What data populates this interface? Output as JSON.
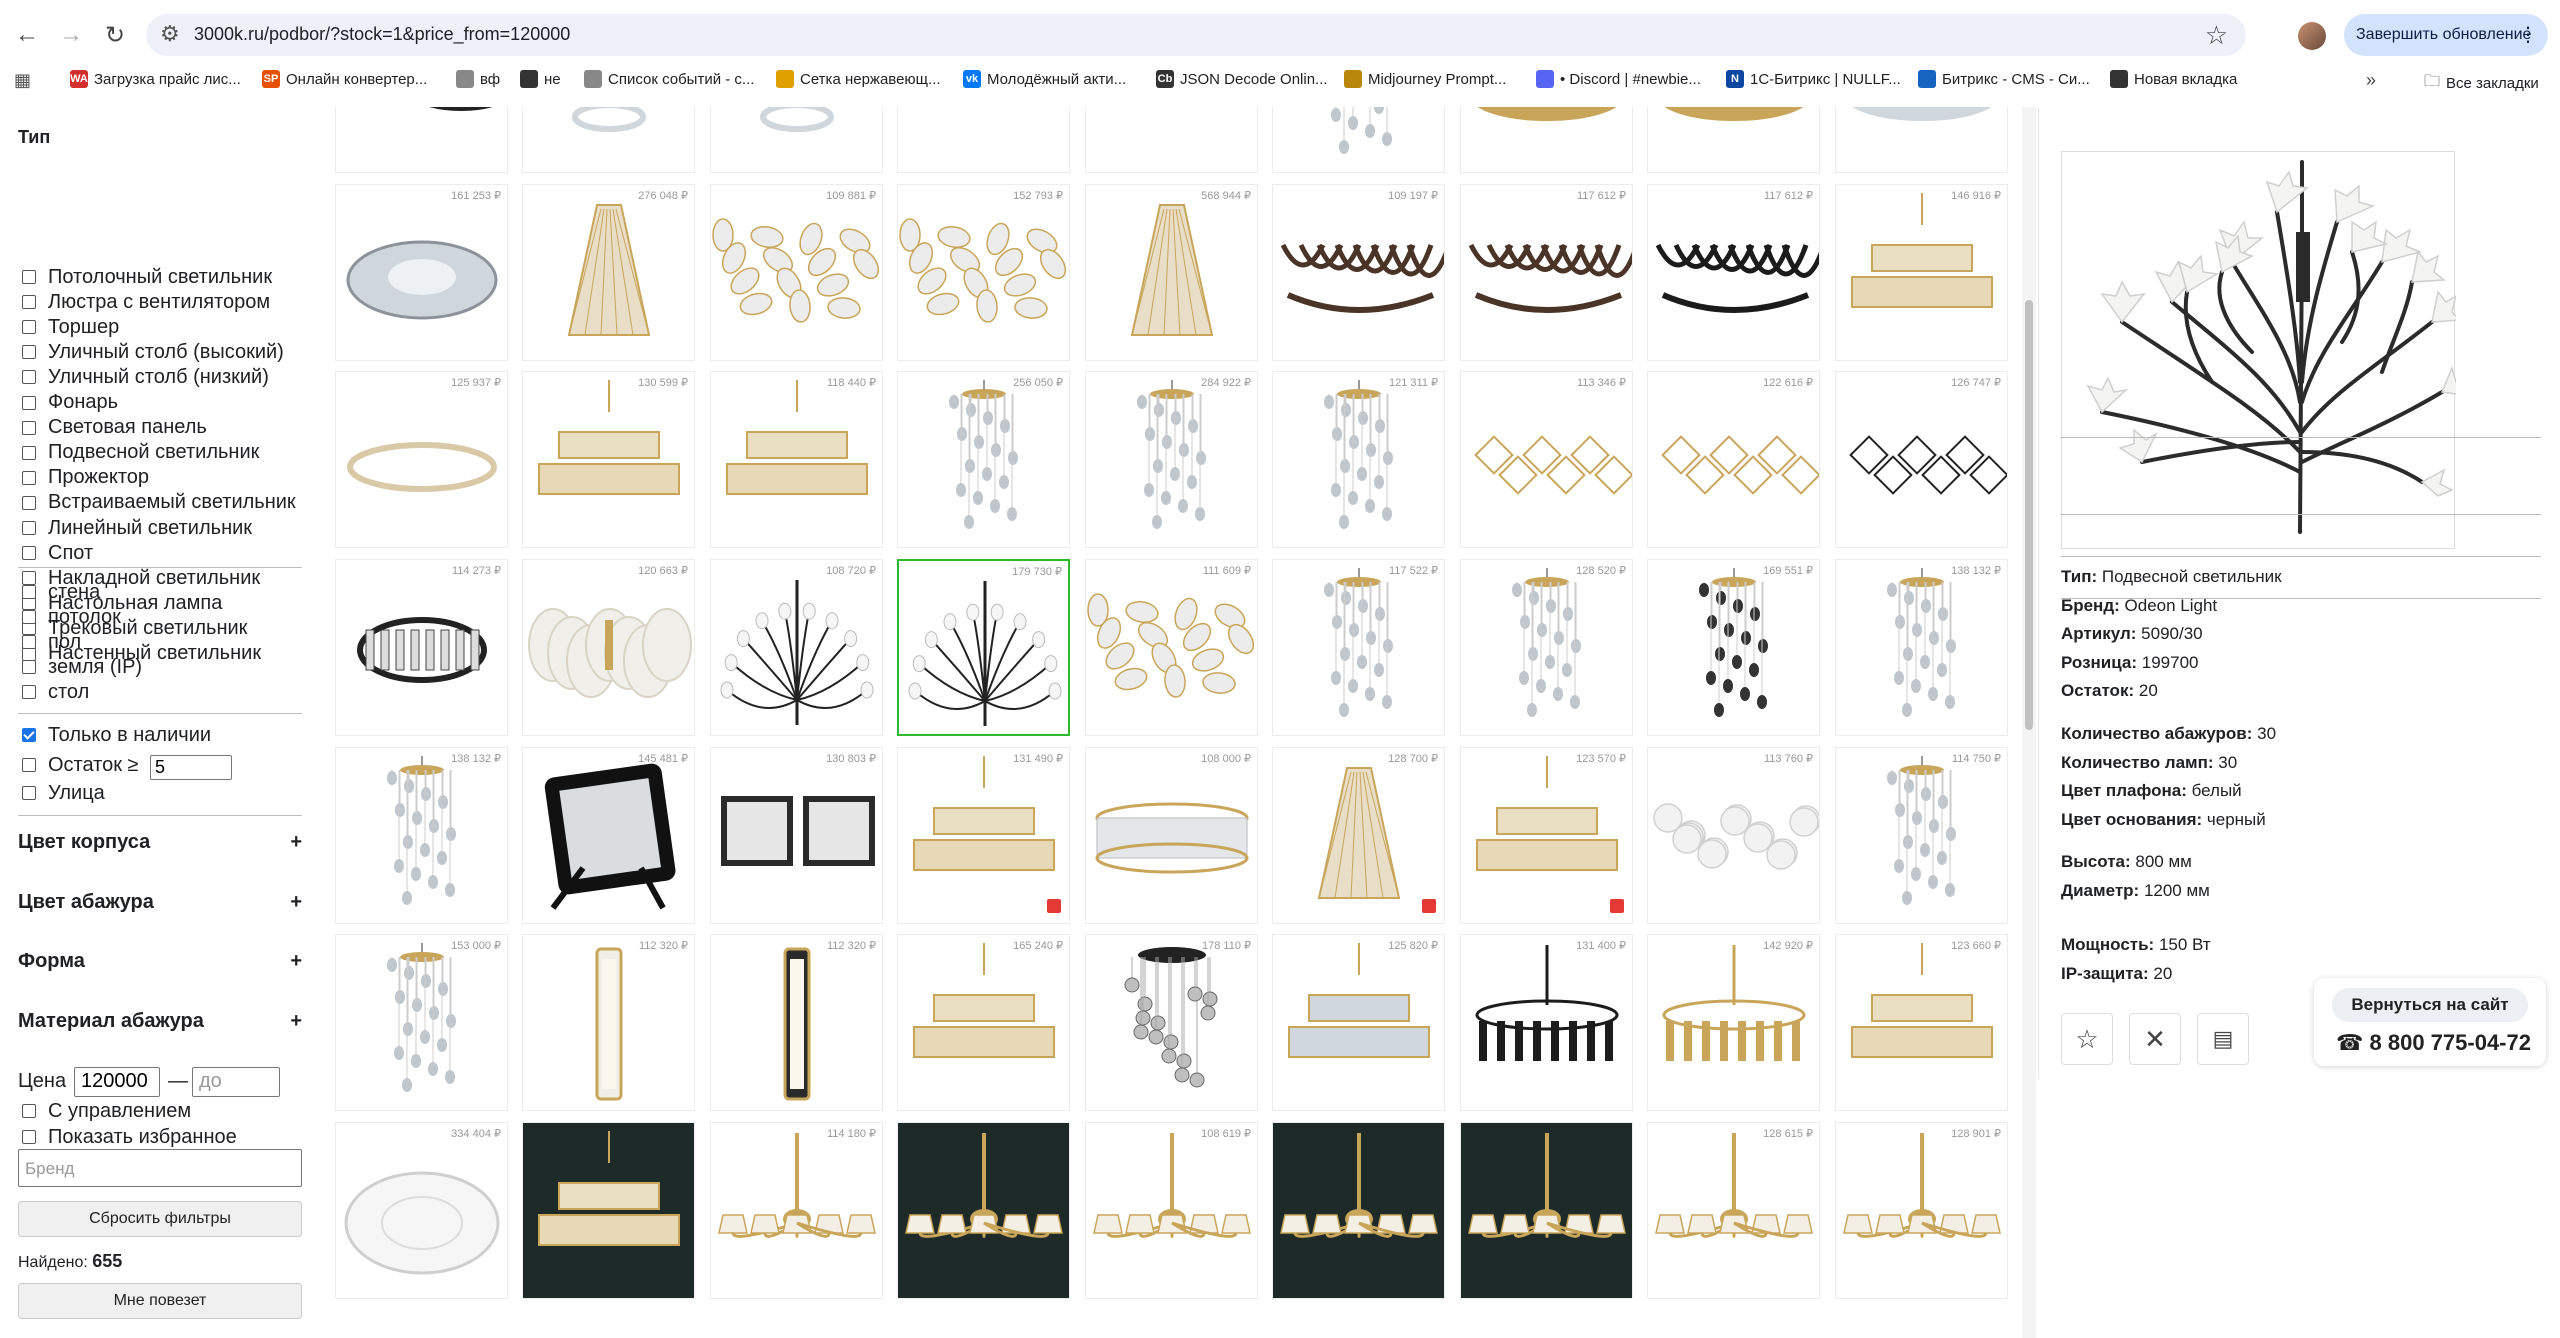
{
  "browser": {
    "url": "3000k.ru/podbor/?stock=1&price_from=120000",
    "update_label": "Завершить обновление",
    "bookmarks": [
      {
        "label": "Загрузка прайс лис...",
        "color": "#d32f2f",
        "glyph": "WA"
      },
      {
        "label": "Онлайн конвертер...",
        "color": "#e65100",
        "glyph": "SP"
      },
      {
        "label": "вф",
        "color": "#888888",
        "glyph": ""
      },
      {
        "label": "не",
        "color": "#333333",
        "glyph": ""
      },
      {
        "label": "Список событий - с...",
        "color": "#888888",
        "glyph": ""
      },
      {
        "label": "Сетка нержавеющ...",
        "color": "#e0a000",
        "glyph": ""
      },
      {
        "label": "Молодёжный акти...",
        "color": "#0077ff",
        "glyph": "vk"
      },
      {
        "label": "JSON Decode Onlin...",
        "color": "#333333",
        "glyph": "Cb"
      },
      {
        "label": "Midjourney Prompt...",
        "color": "#b8860b",
        "glyph": ""
      },
      {
        "label": "• Discord | #newbie...",
        "color": "#5865f2",
        "glyph": ""
      },
      {
        "label": "1С-Битрикс | NULLF...",
        "color": "#0d47a1",
        "glyph": "N"
      },
      {
        "label": "Битрикс - CMS - Си...",
        "color": "#1565c0",
        "glyph": ""
      },
      {
        "label": "Новая вкладка",
        "color": "#333333",
        "glyph": ""
      }
    ],
    "all_bookmarks": "Все закладки"
  },
  "sidebar": {
    "type_title": "Тип",
    "types": [
      {
        "label": "Потолочный светильник",
        "checked": false
      },
      {
        "label": "Люстра с вентилятором",
        "checked": false
      },
      {
        "label": "Торшер",
        "checked": false
      },
      {
        "label": "Уличный столб (высокий)",
        "checked": false
      },
      {
        "label": "Уличный столб (низкий)",
        "checked": false
      },
      {
        "label": "Фонарь",
        "checked": false
      },
      {
        "label": "Световая панель",
        "checked": false
      },
      {
        "label": "Подвесной светильник",
        "checked": false
      },
      {
        "label": "Прожектор",
        "checked": false
      },
      {
        "label": "Встраиваемый светильник",
        "checked": false
      },
      {
        "label": "Линейный светильник",
        "checked": false
      },
      {
        "label": "Спот",
        "checked": false
      },
      {
        "label": "Накладной светильник",
        "checked": false
      },
      {
        "label": "Настольная лампа",
        "checked": false
      },
      {
        "label": "Трековый светильник",
        "checked": false
      },
      {
        "label": "Настенный светильник",
        "checked": false
      }
    ],
    "mounts": [
      {
        "label": "стена",
        "checked": false
      },
      {
        "label": "потолок",
        "checked": false
      },
      {
        "label": "пол",
        "checked": false
      },
      {
        "label": "земля (IP)",
        "checked": false
      },
      {
        "label": "стол",
        "checked": false
      }
    ],
    "in_stock": {
      "label": "Только в наличии",
      "checked": true
    },
    "stock_min": {
      "label": "Остаток ≥",
      "value": "5",
      "checked": false
    },
    "street": {
      "label": "Улица",
      "checked": false
    },
    "accordions": [
      "Цвет корпуса",
      "Цвет абажура",
      "Форма",
      "Материал абажура"
    ],
    "accordion_plus": "+",
    "price_label": "Цена",
    "price_from": "120000",
    "price_dash": "—",
    "price_to_placeholder": "до",
    "with_control": {
      "label": "С управлением",
      "checked": false
    },
    "show_favorites": {
      "label": "Показать избранное",
      "checked": false
    },
    "brand_placeholder": "Бренд",
    "reset_label": "Сбросить фильтры",
    "found_label": "Найдено:",
    "found_count": "655",
    "lucky_label": "Мне повезет"
  },
  "grid": {
    "rows": [
      [
        {
          "price": "",
          "kind": "rings-black"
        },
        {
          "price": "",
          "kind": "spiral"
        },
        {
          "price": "",
          "kind": "spiral"
        },
        {
          "price": "",
          "kind": "stones-pink"
        },
        {
          "price": "",
          "kind": "stones-grey"
        },
        {
          "price": "",
          "kind": "drops"
        },
        {
          "price": "",
          "kind": "ring-gold"
        },
        {
          "price": "",
          "kind": "ring-gold"
        },
        {
          "price": "",
          "kind": "ring-crystal"
        }
      ],
      [
        {
          "price": "161 253 ₽",
          "kind": "flower-crystal"
        },
        {
          "price": "276 048 ₽",
          "kind": "cone-gold"
        },
        {
          "price": "109 881 ₽",
          "kind": "leaves-white"
        },
        {
          "price": "152 793 ₽",
          "kind": "leaves-white"
        },
        {
          "price": "568 944 ₽",
          "kind": "cone-gold"
        },
        {
          "price": "109 197 ₽",
          "kind": "ribbons-brown"
        },
        {
          "price": "117 612 ₽",
          "kind": "ribbons-brown"
        },
        {
          "price": "117 612 ₽",
          "kind": "ribbons-black"
        },
        {
          "price": "146 916 ₽",
          "kind": "tier-gold"
        }
      ],
      [
        {
          "price": "125 937 ₽",
          "kind": "ring-thin"
        },
        {
          "price": "130 599 ₽",
          "kind": "tier-gold"
        },
        {
          "price": "118 440 ₽",
          "kind": "tier-gold"
        },
        {
          "price": "256 050 ₽",
          "kind": "drops"
        },
        {
          "price": "284 922 ₽",
          "kind": "drops"
        },
        {
          "price": "121 311 ₽",
          "kind": "drops"
        },
        {
          "price": "113 346 ₽",
          "kind": "cubes-gold"
        },
        {
          "price": "122 616 ₽",
          "kind": "cubes-gold"
        },
        {
          "price": "126 747 ₽",
          "kind": "cubes-dark"
        }
      ],
      [
        {
          "price": "114 273 ₽",
          "kind": "ring-black"
        },
        {
          "price": "120 663 ₽",
          "kind": "shells"
        },
        {
          "price": "108 720 ₽",
          "kind": "tree"
        },
        {
          "price": "179 730 ₽",
          "kind": "tree",
          "selected": true
        },
        {
          "price": "111 609 ₽",
          "kind": "leaves-white"
        },
        {
          "price": "117 522 ₽",
          "kind": "drops"
        },
        {
          "price": "128 520 ₽",
          "kind": "drops"
        },
        {
          "price": "169 551 ₽",
          "kind": "drops-dark"
        },
        {
          "price": "138 132 ₽",
          "kind": "drops"
        }
      ],
      [
        {
          "price": "138 132 ₽",
          "kind": "drops"
        },
        {
          "price": "145 481 ₽",
          "kind": "floodlight"
        },
        {
          "price": "130 803 ₽",
          "kind": "floodlight-double"
        },
        {
          "price": "131 490 ₽",
          "kind": "tier-gold",
          "gift": true
        },
        {
          "price": "108 000 ₽",
          "kind": "drum"
        },
        {
          "price": "128 700 ₽",
          "kind": "cone-gold",
          "gift": true
        },
        {
          "price": "123 570 ₽",
          "kind": "tier-gold",
          "gift": true
        },
        {
          "price": "113 760 ₽",
          "kind": "bubbles"
        },
        {
          "price": "114 750 ₽",
          "kind": "drops"
        }
      ],
      [
        {
          "price": "153 000 ₽",
          "kind": "drops"
        },
        {
          "price": "112 320 ₽",
          "kind": "tube"
        },
        {
          "price": "112 320 ₽",
          "kind": "tube-dark"
        },
        {
          "price": "165 240 ₽",
          "kind": "tier-gold"
        },
        {
          "price": "178 110 ₽",
          "kind": "balls-dark"
        },
        {
          "price": "125 820 ₽",
          "kind": "tier-crystal"
        },
        {
          "price": "131 400 ₽",
          "kind": "spider-black"
        },
        {
          "price": "142 920 ₽",
          "kind": "spider-gold"
        },
        {
          "price": "123 660 ₽",
          "kind": "tier-gold"
        }
      ],
      [
        {
          "price": "334 404 ₽",
          "kind": "plate"
        },
        {
          "price": "",
          "kind": "tier-gold",
          "dark": true
        },
        {
          "price": "114 180 ₽",
          "kind": "classic"
        },
        {
          "price": "",
          "kind": "classic",
          "dark": true
        },
        {
          "price": "108 619 ₽",
          "kind": "classic"
        },
        {
          "price": "",
          "kind": "classic",
          "dark": true
        },
        {
          "price": "",
          "kind": "classic",
          "dark": true
        },
        {
          "price": "128 615 ₽",
          "kind": "classic"
        },
        {
          "price": "128 901 ₽",
          "kind": "classic"
        }
      ]
    ]
  },
  "detail": {
    "fields_a": [
      {
        "label": "Тип:",
        "value": "Подвесной светильник"
      },
      {
        "label": "Бренд:",
        "value": "Odeon Light"
      },
      {
        "label": "Артикул:",
        "value": "5090/30"
      },
      {
        "label": "Розница:",
        "value": "199700"
      },
      {
        "label": "Остаток:",
        "value": "20"
      }
    ],
    "fields_b": [
      {
        "label": "Количество абажуров:",
        "value": "30"
      },
      {
        "label": "Количество ламп:",
        "value": "30"
      },
      {
        "label": "Цвет плафона:",
        "value": "белый"
      },
      {
        "label": "Цвет основания:",
        "value": "черный"
      }
    ],
    "fields_c": [
      {
        "label": "Высота:",
        "value": "800 мм"
      },
      {
        "label": "Диаметр:",
        "value": "1200 мм"
      }
    ],
    "fields_d": [
      {
        "label": "Мощность:",
        "value": "150 Вт"
      },
      {
        "label": "IP-защита:",
        "value": "20"
      }
    ],
    "back_label": "Вернуться на сайт",
    "phone": "☎ 8 800 775-04-72"
  }
}
